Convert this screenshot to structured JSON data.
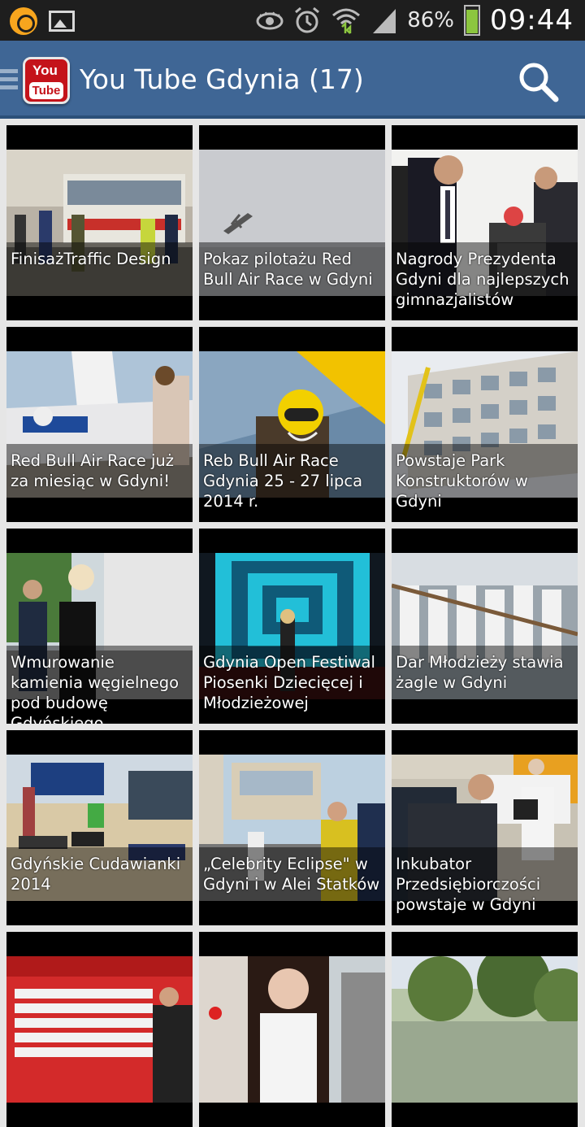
{
  "status_bar": {
    "icons_left": [
      "app-notification-icon",
      "image-notification-icon"
    ],
    "icons_right": [
      "eye-icon",
      "alarm-icon",
      "wifi-icon",
      "signal-icon"
    ],
    "battery_percent": "86%",
    "battery_level": 0.86,
    "time": "09:44"
  },
  "app_bar": {
    "logo_top": "You",
    "logo_bottom": "Tube",
    "title": "You Tube Gdynia (17)",
    "search_icon": "search-icon",
    "menu_icon": "menu-icon"
  },
  "videos": [
    {
      "title": "FinisażTraffic Design"
    },
    {
      "title": "Pokaz pilotażu Red Bull Air Race w Gdyni"
    },
    {
      "title": "Nagrody Prezydenta Gdyni dla najlepszych gimnazjalistów"
    },
    {
      "title": "Red Bull Air Race już za miesiąc w Gdyni!"
    },
    {
      "title": "Reb Bull Air Race Gdynia 25 - 27 lipca 2014 r."
    },
    {
      "title": "Powstaje Park Konstruktorów w Gdyni"
    },
    {
      "title": "Wmurowanie kamienia węgielnego pod budowę Gdyńskiego"
    },
    {
      "title": "Gdynia Open Festiwal Piosenki Dziecięcej i Młodzieżowej"
    },
    {
      "title": "Dar Młodzieży stawia żagle w Gdyni"
    },
    {
      "title": "Gdyńskie Cudawianki 2014"
    },
    {
      "title": "„Celebrity Eclipse\" w Gdyni i w Alei Statków"
    },
    {
      "title": "Inkubator Przedsiębiorczości powstaje w Gdyni"
    },
    {
      "title": ""
    },
    {
      "title": ""
    },
    {
      "title": ""
    }
  ]
}
